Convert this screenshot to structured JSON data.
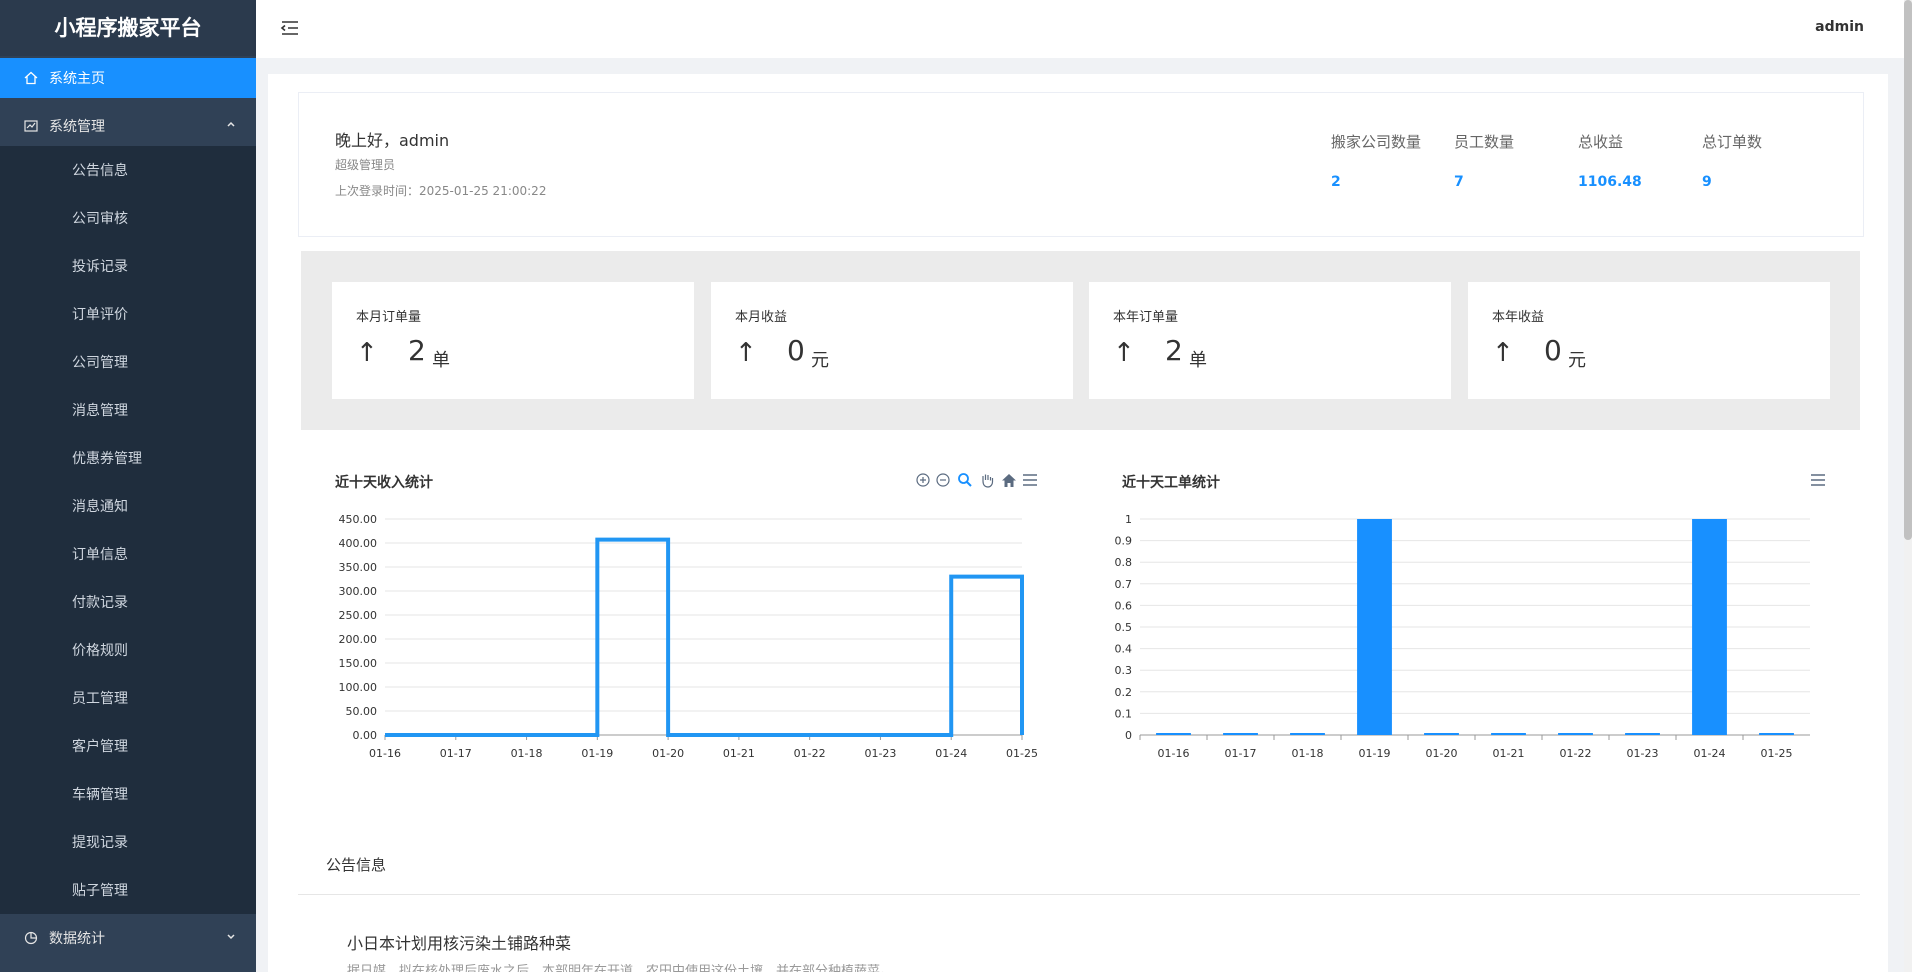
{
  "app": {
    "title": "小程序搬家平台"
  },
  "header": {
    "user": "admin"
  },
  "sidebar": {
    "home": "系统主页",
    "system": "系统管理",
    "sub": [
      "公告信息",
      "公司审核",
      "投诉记录",
      "订单评价",
      "公司管理",
      "消息管理",
      "优惠券管理",
      "消息通知",
      "订单信息",
      "付款记录",
      "价格规则",
      "员工管理",
      "客户管理",
      "车辆管理",
      "提现记录",
      "贴子管理"
    ],
    "stats": "数据统计"
  },
  "welcome": {
    "greeting": "晚上好，admin",
    "role": "超级管理员",
    "last_login": "上次登录时间：2025-01-25 21:00:22",
    "stats": [
      {
        "label": "搬家公司数量",
        "value": "2"
      },
      {
        "label": "员工数量",
        "value": "7"
      },
      {
        "label": "总收益",
        "value": "1106.48"
      },
      {
        "label": "总订单数",
        "value": "9"
      }
    ]
  },
  "summary": [
    {
      "title": "本月订单量",
      "arrow": "↑",
      "value": "2",
      "unit": "单"
    },
    {
      "title": "本月收益",
      "arrow": "↑",
      "value": "0",
      "unit": "元"
    },
    {
      "title": "本年订单量",
      "arrow": "↑",
      "value": "2",
      "unit": "单"
    },
    {
      "title": "本年收益",
      "arrow": "↑",
      "value": "0",
      "unit": "元"
    }
  ],
  "chart_data": [
    {
      "type": "line",
      "title": "近十天收入统计",
      "categories": [
        "01-16",
        "01-17",
        "01-18",
        "01-19",
        "01-20",
        "01-21",
        "01-22",
        "01-23",
        "01-24",
        "01-25"
      ],
      "values": [
        0,
        0,
        0,
        407,
        0,
        0,
        0,
        0,
        330,
        0
      ],
      "ylim": [
        0,
        450
      ],
      "yticks": [
        "0.00",
        "50.00",
        "100.00",
        "150.00",
        "200.00",
        "250.00",
        "300.00",
        "350.00",
        "400.00",
        "450.00"
      ],
      "color": "#2196f3",
      "step": true
    },
    {
      "type": "bar",
      "title": "近十天工单统计",
      "categories": [
        "01-16",
        "01-17",
        "01-18",
        "01-19",
        "01-20",
        "01-21",
        "01-22",
        "01-23",
        "01-24",
        "01-25"
      ],
      "values": [
        0,
        0,
        0,
        1,
        0,
        0,
        0,
        0,
        1,
        0
      ],
      "ylim": [
        0,
        1
      ],
      "yticks": [
        "0",
        "0.1",
        "0.2",
        "0.3",
        "0.4",
        "0.5",
        "0.6",
        "0.7",
        "0.8",
        "0.9",
        "1"
      ],
      "color": "#1890ff"
    }
  ],
  "notice": {
    "title": "公告信息",
    "item_title": "小日本计划用核污染土铺路种菜",
    "item_snippet": "据日媒，拟在核处理后废水之后，本部明年在开道、农田中使用这份土壤，并在部分种植蔬菜。"
  }
}
